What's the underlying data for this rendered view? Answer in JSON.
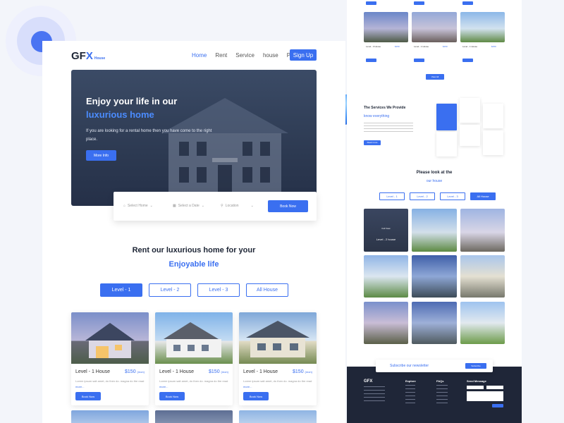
{
  "nav": {
    "logo_text": "GF",
    "logo_x": "X",
    "logo_sub": "House",
    "links": [
      "Home",
      "Rent",
      "Service",
      "house",
      "Pay"
    ],
    "signup": "Sign Up"
  },
  "hero": {
    "title_line1": "Enjoy your life in our",
    "title_line2": "luxurious home",
    "body": "If you are looking for a rental home then you have come to the right place.",
    "more_button": "More Info"
  },
  "search": {
    "home": "Select Home",
    "date": "Select a Date",
    "location": "Location",
    "book": "Book Now"
  },
  "rent": {
    "title": "Rent our luxurious home for your",
    "subtitle": "Enjoyable life"
  },
  "tabs": [
    "Level - 1",
    "Level - 2",
    "Level - 3",
    "All House"
  ],
  "cards": [
    {
      "level": "Level - 1 House",
      "price": "$150",
      "unit": "(mon)",
      "desc": "Lorem ipsum sait amet, do then do. magna do the read",
      "more": "more...",
      "button": "Book Now"
    },
    {
      "level": "Level - 1 House",
      "price": "$150",
      "unit": "(mon)",
      "desc": "Lorem ipsum sait amet, do then do. magna do the read",
      "more": "more...",
      "button": "Book Now"
    },
    {
      "level": "Level - 1 House",
      "price": "$150",
      "unit": "(mon)",
      "desc": "Lorem ipsum sait amet, do then do. magna do the read",
      "more": "more...",
      "button": "Book Now"
    }
  ],
  "side": {
    "top_cards": [
      {
        "level": "Level - 3 House",
        "price": "$150"
      },
      {
        "level": "Level - 1 House",
        "price": "$150"
      },
      {
        "level": "Level - 1 House",
        "price": "$150"
      }
    ],
    "view_all": "View All",
    "services_title": "The Services We Provide",
    "services_sub": "know everything",
    "services_btn": "Read more",
    "look_title": "Please look at the",
    "look_sub": "our house",
    "level_tabs": [
      "Level - 1",
      "Level - 2",
      "Level - 3",
      "All House"
    ],
    "overlay_label": "Level - 2 house",
    "overlay_view": "Full View",
    "newsletter": "Subscribe our newsletter",
    "newsletter_btn": "Subscribe",
    "footer_logo": "GFX",
    "footer_cols": [
      "Explore",
      "FAQs",
      "Send Message"
    ]
  },
  "colors": {
    "accent": "#3a6ff0",
    "dark": "#1f2638"
  }
}
